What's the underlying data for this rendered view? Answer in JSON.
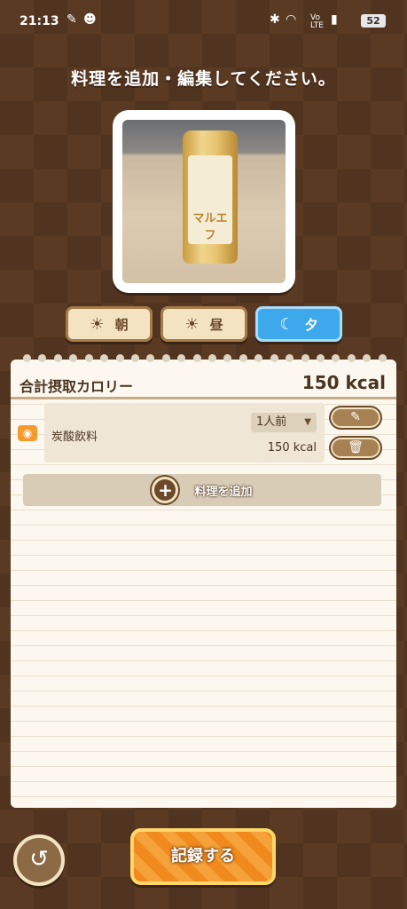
{
  "status_bar": {
    "time": "21:13",
    "battery": "52"
  },
  "title": "料理を追加・編集してください。",
  "photo": {
    "can_text": "マルエフ"
  },
  "meals": [
    {
      "label": "朝",
      "icon": "sunrise-icon",
      "active": false
    },
    {
      "label": "昼",
      "icon": "sun-icon",
      "active": false
    },
    {
      "label": "夕",
      "icon": "moon-icon",
      "active": true
    }
  ],
  "summary": {
    "label": "合計摂取カロリー",
    "value": "150 kcal"
  },
  "items": [
    {
      "name": "炭酸飲料",
      "portion": "1人前",
      "kcal": "150 kcal"
    }
  ],
  "add_food_label": "料理を追加",
  "record_label": "記録する",
  "colors": {
    "active_meal": "#3da8ec",
    "record_button": "#f08a1f",
    "background": "#5a3a22"
  }
}
